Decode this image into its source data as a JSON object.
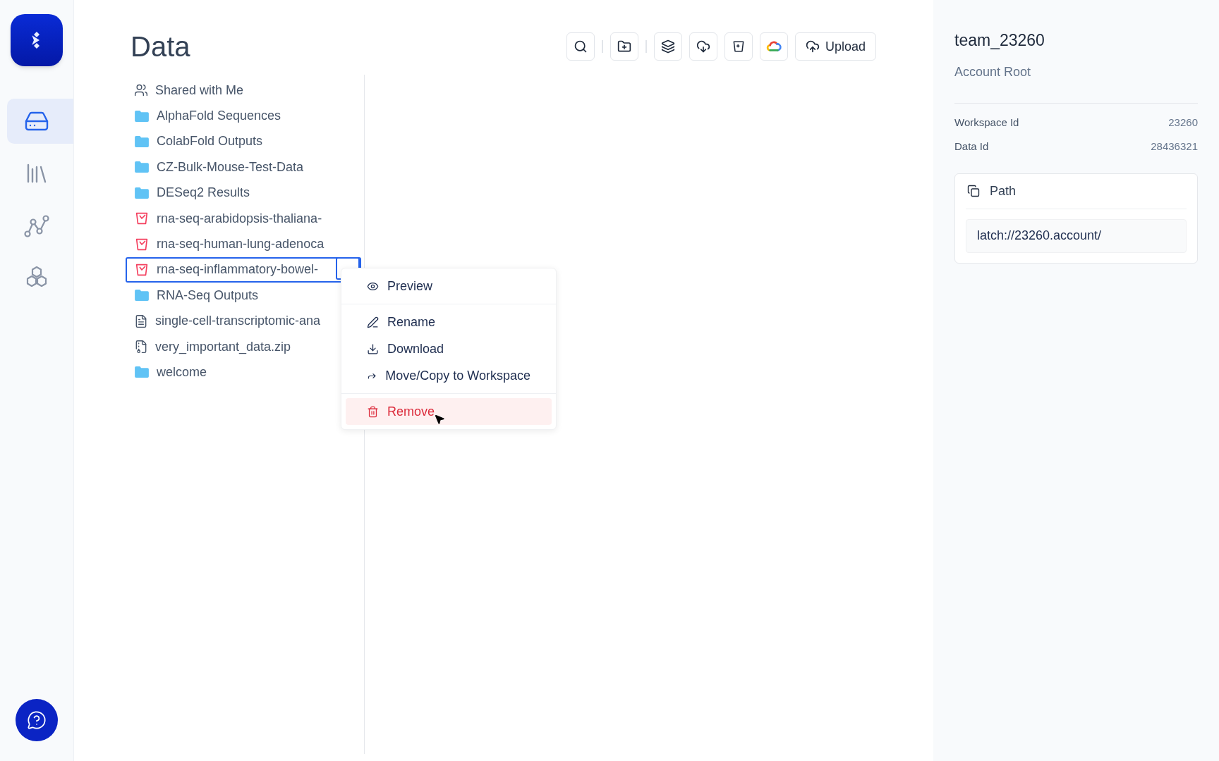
{
  "nav": [
    {
      "selected": true
    },
    {
      "selected": false
    },
    {
      "selected": false
    },
    {
      "selected": false
    }
  ],
  "page": {
    "title": "Data"
  },
  "toolbar": {
    "upload": "Upload"
  },
  "files": [
    {
      "name": "Shared with Me",
      "kind": "shared",
      "selected": false
    },
    {
      "name": "AlphaFold Sequences",
      "kind": "folder",
      "selected": false
    },
    {
      "name": "ColabFold Outputs",
      "kind": "folder",
      "selected": false
    },
    {
      "name": "CZ-Bulk-Mouse-Test-Data",
      "kind": "folder",
      "selected": false
    },
    {
      "name": "DESeq2 Results",
      "kind": "folder",
      "selected": false
    },
    {
      "name": "rna-seq-arabidopsis-thaliana-",
      "kind": "bucket",
      "selected": false
    },
    {
      "name": "rna-seq-human-lung-adenoca",
      "kind": "bucket",
      "selected": false
    },
    {
      "name": "rna-seq-inflammatory-bowel-",
      "kind": "bucket",
      "selected": true
    },
    {
      "name": "RNA-Seq Outputs",
      "kind": "folder",
      "selected": false
    },
    {
      "name": "single-cell-transcriptomic-ana",
      "kind": "document",
      "selected": false
    },
    {
      "name": "very_important_data.zip",
      "kind": "archive",
      "selected": false
    },
    {
      "name": "welcome",
      "kind": "folder",
      "selected": false
    }
  ],
  "context_menu": {
    "sections": [
      [
        {
          "label": "Preview",
          "kind": "normal",
          "highlighted": false
        }
      ],
      [
        {
          "label": "Rename",
          "kind": "normal",
          "highlighted": false
        },
        {
          "label": "Download",
          "kind": "normal",
          "highlighted": false
        },
        {
          "label": "Move/Copy to Workspace",
          "kind": "normal",
          "highlighted": false
        }
      ],
      [
        {
          "label": "Remove",
          "kind": "danger",
          "highlighted": true
        }
      ]
    ]
  },
  "details": {
    "title": "team_23260",
    "subtitle": "Account Root",
    "fields": [
      {
        "label": "Workspace Id",
        "value": "23260"
      },
      {
        "label": "Data Id",
        "value": "28436321"
      }
    ],
    "path": {
      "label": "Path",
      "value": "latch://23260.account/"
    }
  }
}
